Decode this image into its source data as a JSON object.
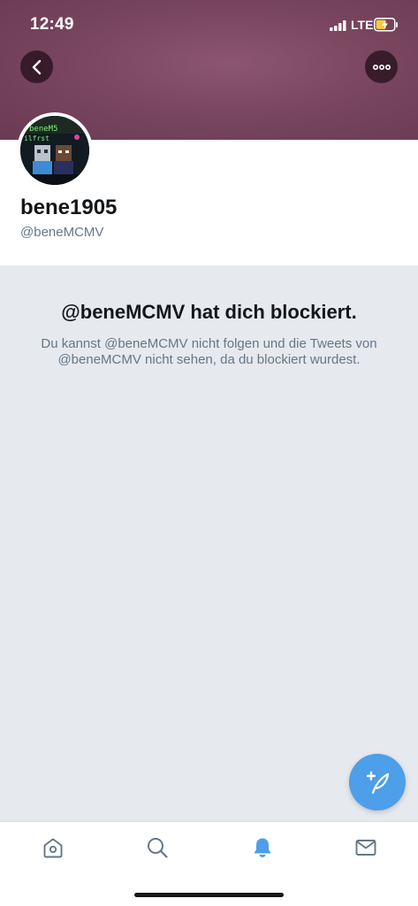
{
  "status_bar": {
    "time": "12:49",
    "network": "LTE"
  },
  "header": {
    "back_icon": "chevron-left-icon",
    "more_icon": "more-horizontal-icon"
  },
  "profile": {
    "display_name": "bene1905",
    "handle": "@beneMCMV",
    "avatar_lines": [
      "beneM5",
      "ilfrst"
    ]
  },
  "blocked": {
    "title": "@beneMCMV hat dich blockiert.",
    "description": "Du kannst @beneMCMV nicht folgen und die Tweets von @beneMCMV nicht sehen, da du blockiert wurdest."
  },
  "fab": {
    "icon": "compose-tweet-icon"
  },
  "tab_bar": {
    "tabs": [
      {
        "name": "home",
        "icon": "home-icon",
        "active": false
      },
      {
        "name": "search",
        "icon": "search-icon",
        "active": false
      },
      {
        "name": "notifications",
        "icon": "bell-icon",
        "active": true
      },
      {
        "name": "messages",
        "icon": "mail-icon",
        "active": false
      }
    ]
  },
  "colors": {
    "accent": "#4c9fe8",
    "banner": "#7a4660",
    "blocked_background": "#e6e9ee",
    "icon_inactive": "#657786"
  }
}
